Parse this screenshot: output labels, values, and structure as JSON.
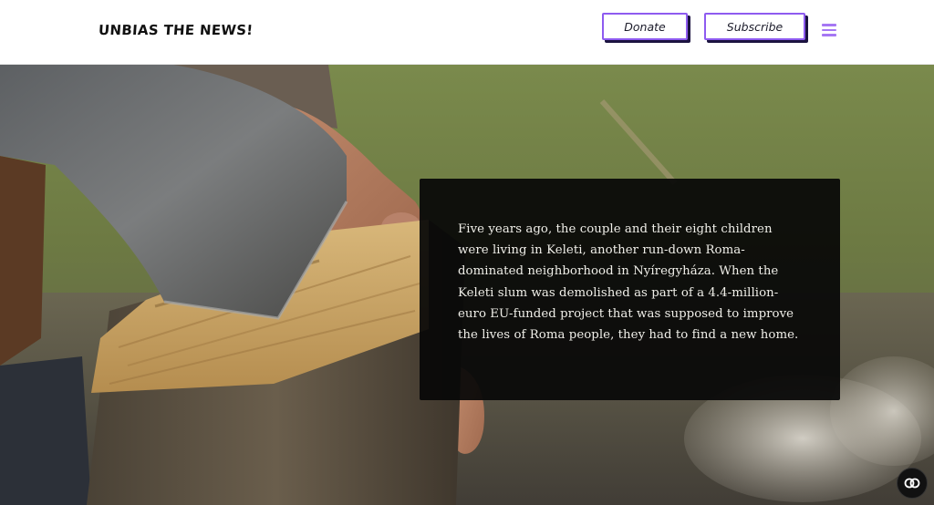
{
  "header": {
    "logo": "UNBIAS THE NEWS!",
    "donate_label": "Donate",
    "subscribe_label": "Subscribe",
    "menu_icon": "hamburger-menu-icon"
  },
  "hero": {
    "image_subject": "axe splitting a block of wood held by a hand",
    "paragraph": "Five years ago, the couple and their eight children were living in Keleti, another run-down Roma-dominated neighborhood in Nyíregyháza. When the Keleti slum was demolished as part of a 4.4-million-euro EU-funded project that was supposed to improve the lives of Roma people, they had to find a new home."
  },
  "chat_widget": {
    "icon": "chat-bubble-icon"
  },
  "colors": {
    "accent": "#8e5bf0",
    "menu_icon": "#a677f4",
    "panel_background": "#080808",
    "panel_text": "#f0efe9"
  }
}
